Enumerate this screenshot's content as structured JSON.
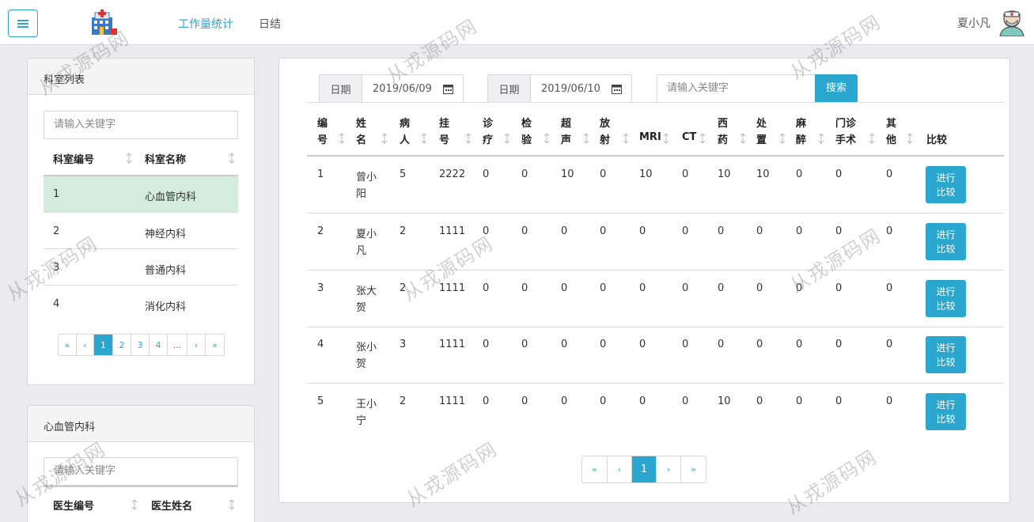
{
  "nav": {
    "links": [
      "工作量统计",
      "日结"
    ],
    "user_name": "夏小凡"
  },
  "dept_panel": {
    "title": "科室列表",
    "search_placeholder": "请输入关键字",
    "columns": [
      "科室编号",
      "科室名称"
    ],
    "rows": [
      {
        "id": "1",
        "name": "心血管内科",
        "selected": true
      },
      {
        "id": "2",
        "name": "神经内科",
        "selected": false
      },
      {
        "id": "3",
        "name": "普通内科",
        "selected": false
      },
      {
        "id": "4",
        "name": "消化内科",
        "selected": false
      }
    ],
    "pagination": [
      "«",
      "‹",
      "1",
      "2",
      "3",
      "4",
      "...",
      "›",
      "»"
    ],
    "pagination_active": "1"
  },
  "doctor_panel": {
    "title": "心血管内科",
    "search_placeholder": "请输入关键字",
    "columns": [
      "医生编号",
      "医生姓名"
    ]
  },
  "main": {
    "date_label_1": "日期",
    "date_value_1": "2019/06/09",
    "date_label_2": "日期",
    "date_value_2": "2019/06/10",
    "search_placeholder": "请输入关键字",
    "search_button": "搜索",
    "columns": [
      [
        "编",
        "号"
      ],
      [
        "姓",
        "名"
      ],
      [
        "病",
        "人"
      ],
      [
        "挂",
        "号"
      ],
      [
        "诊",
        "疗"
      ],
      [
        "检",
        "验"
      ],
      [
        "超",
        "声"
      ],
      [
        "放",
        "射"
      ],
      [
        "",
        "MRI"
      ],
      [
        "",
        "CT"
      ],
      [
        "西",
        "药"
      ],
      [
        "处",
        "置"
      ],
      [
        "麻",
        "醉"
      ],
      [
        "门诊",
        "手术"
      ],
      [
        "其",
        "他"
      ],
      [
        "",
        "比较"
      ]
    ],
    "rows": [
      {
        "no": "1",
        "name": [
          "曾小",
          "阳"
        ],
        "vals": [
          "5",
          "2222",
          "0",
          "0",
          "10",
          "0",
          "10",
          "0",
          "10",
          "10",
          "0",
          "0",
          "0"
        ]
      },
      {
        "no": "2",
        "name": [
          "夏小",
          "凡"
        ],
        "vals": [
          "2",
          "1111",
          "0",
          "0",
          "0",
          "0",
          "0",
          "0",
          "0",
          "0",
          "0",
          "0",
          "0"
        ]
      },
      {
        "no": "3",
        "name": [
          "张大",
          "贺"
        ],
        "vals": [
          "2",
          "1111",
          "0",
          "0",
          "0",
          "0",
          "0",
          "0",
          "0",
          "0",
          "0",
          "0",
          "0"
        ]
      },
      {
        "no": "4",
        "name": [
          "张小",
          "贺"
        ],
        "vals": [
          "3",
          "1111",
          "0",
          "0",
          "0",
          "0",
          "0",
          "0",
          "0",
          "0",
          "0",
          "0",
          "0"
        ]
      },
      {
        "no": "5",
        "name": [
          "王小",
          "宁"
        ],
        "vals": [
          "2",
          "1111",
          "0",
          "0",
          "0",
          "0",
          "0",
          "0",
          "10",
          "0",
          "0",
          "0",
          "0"
        ]
      }
    ],
    "compare_button": [
      "进行",
      "比较"
    ],
    "pagination": [
      "«",
      "‹",
      "1",
      "›",
      "»"
    ],
    "pagination_active": "1"
  },
  "watermark": "从戎源码网",
  "colors": {
    "accent": "#2aa6cf",
    "selected_row": "#d4edda"
  }
}
